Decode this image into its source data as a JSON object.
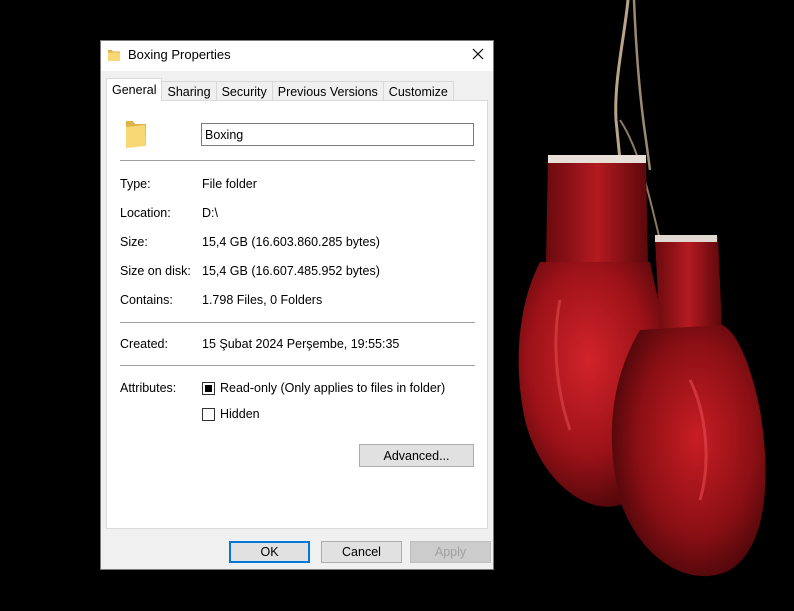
{
  "window": {
    "title": "Boxing Properties",
    "close_symbol": "✕"
  },
  "tabs": [
    {
      "label": "General",
      "active": true
    },
    {
      "label": "Sharing",
      "active": false
    },
    {
      "label": "Security",
      "active": false
    },
    {
      "label": "Previous Versions",
      "active": false
    },
    {
      "label": "Customize",
      "active": false
    }
  ],
  "general": {
    "name": "Boxing",
    "type_label": "Type:",
    "type_value": "File folder",
    "location_label": "Location:",
    "location_value": "D:\\",
    "size_label": "Size:",
    "size_value": "15,4 GB (16.603.860.285 bytes)",
    "size_on_disk_label": "Size on disk:",
    "size_on_disk_value": "15,4 GB (16.607.485.952 bytes)",
    "contains_label": "Contains:",
    "contains_value": "1.798 Files, 0 Folders",
    "created_label": "Created:",
    "created_value": "15 Şubat 2024 Perşembe, 19:55:35",
    "attributes_label": "Attributes:",
    "readonly_label": "Read-only (Only applies to files in folder)",
    "readonly_state": "indeterminate",
    "hidden_label": "Hidden",
    "hidden_checked": false,
    "advanced_label": "Advanced..."
  },
  "buttons": {
    "ok": "OK",
    "cancel": "Cancel",
    "apply": "Apply"
  },
  "icons": {
    "title": "folder-icon",
    "large": "folder-icon",
    "close": "close-icon"
  },
  "colors": {
    "folder_yellow": "#f8d775",
    "folder_yellow_dark": "#e0b34a",
    "glove_red": "#a8141b",
    "accent_blue": "#0078d7"
  }
}
